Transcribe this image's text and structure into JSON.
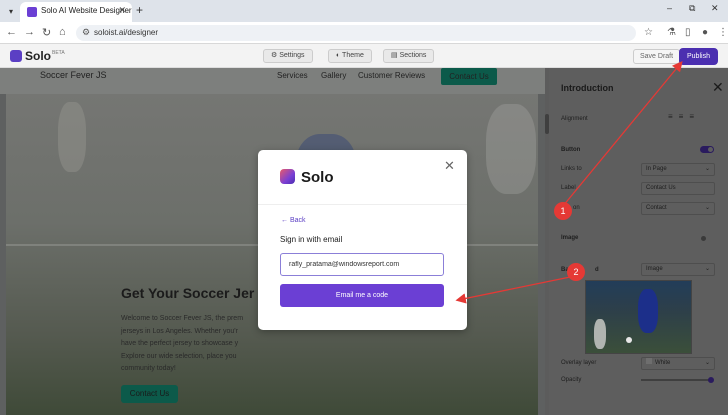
{
  "browser": {
    "tab_title": "Solo AI Website Designer",
    "tab_close": "✕",
    "new_tab": "+",
    "url": "soloist.ai/designer",
    "window_controls": [
      "–",
      "⧉",
      "✕"
    ]
  },
  "app": {
    "logo": "Solo",
    "beta": "BETA",
    "settings": "Settings",
    "theme": "Theme",
    "sections": "Sections",
    "save_draft": "Save Draft",
    "publish": "Publish"
  },
  "site": {
    "brand": "Soccer Fever JS",
    "nav": [
      "Services",
      "Gallery",
      "Customer Reviews"
    ],
    "nav_cta": "Contact Us",
    "hero_title": "Get Your Soccer Jer",
    "hero_lines": [
      "Welcome to Soccer Fever JS, the prem",
      "jerseys in Los Angeles. Whether you'r",
      "have the perfect jersey to showcase y",
      "Explore our wide selection, place you",
      "community today!"
    ],
    "hero_button": "Contact Us"
  },
  "panel": {
    "title": "Introduction",
    "alignment": "Alignment",
    "button": "Button",
    "links_to": "Links to",
    "links_to_value": "In Page",
    "label": "Label",
    "label_value": "Contact Us",
    "action": "on",
    "action_value": "Contact",
    "image": "Image",
    "background": "Bac",
    "background_tail": "d",
    "background_value": "Image",
    "overlay": "Overlay layer",
    "overlay_value": "White",
    "opacity": "Opacity"
  },
  "modal": {
    "logo": "Solo",
    "back": "Back",
    "heading": "Sign in with email",
    "email_value": "rafly_pratama@windowsreport.com",
    "button": "Email me a code"
  },
  "annotations": {
    "badge1": "1",
    "badge2": "2",
    "color": "#e53935"
  }
}
